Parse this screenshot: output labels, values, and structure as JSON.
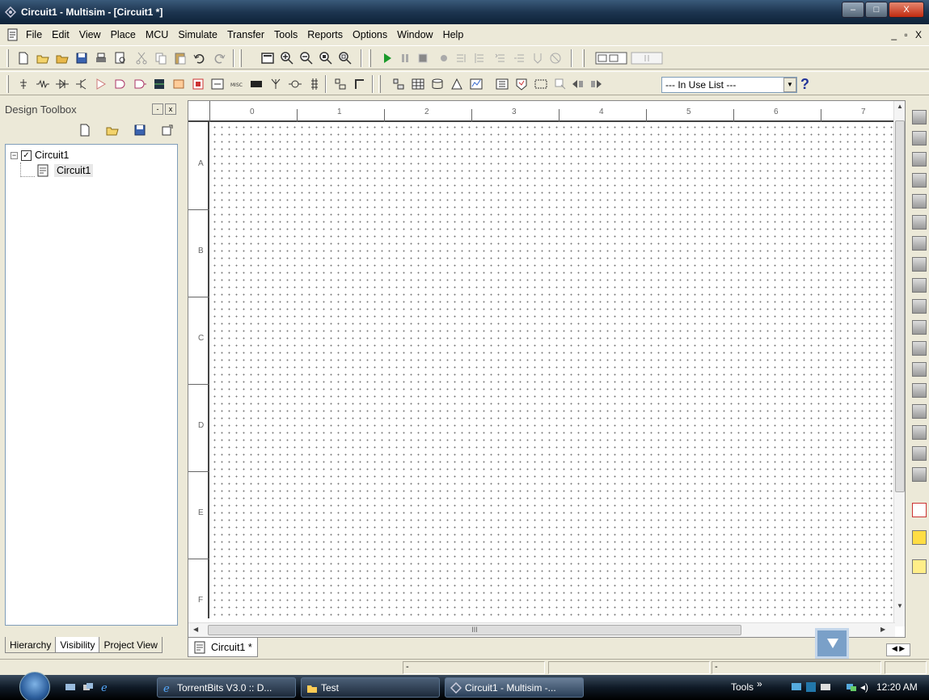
{
  "window": {
    "title": "Circuit1 - Multisim - [Circuit1 *]",
    "min_label": "–",
    "max_label": "□",
    "close_label": "X"
  },
  "menu": {
    "items": [
      "File",
      "Edit",
      "View",
      "Place",
      "MCU",
      "Simulate",
      "Transfer",
      "Tools",
      "Reports",
      "Options",
      "Window",
      "Help"
    ],
    "mdi_controls": "_ ▫ X"
  },
  "toolbar": {
    "in_use_list": "--- In Use List ---",
    "help_label": "?"
  },
  "toolbox": {
    "title": "Design Toolbox",
    "minimize_label": "-",
    "close_label": "x",
    "tree": {
      "root_label": "Circuit1",
      "child_label": "Circuit1",
      "expander": "−",
      "checkbox": "✓"
    },
    "tabs": [
      "Hierarchy",
      "Visibility",
      "Project View"
    ]
  },
  "workspace": {
    "ruler_top": [
      "0",
      "1",
      "2",
      "3",
      "4",
      "5",
      "6",
      "7"
    ],
    "ruler_left": [
      "A",
      "B",
      "C",
      "D",
      "E",
      "F"
    ],
    "scroll_grip": "III",
    "doc_tab": "Circuit1 *"
  },
  "statusbar": {
    "panel1": "-",
    "panel2": "-"
  },
  "taskbar": {
    "tasks": [
      "TorrentBits V3.0 :: D...",
      "Test",
      "Circuit1 - Multisim -..."
    ],
    "tools_label": "Tools",
    "tools_chevron": "»",
    "clock": "12:20 AM"
  }
}
